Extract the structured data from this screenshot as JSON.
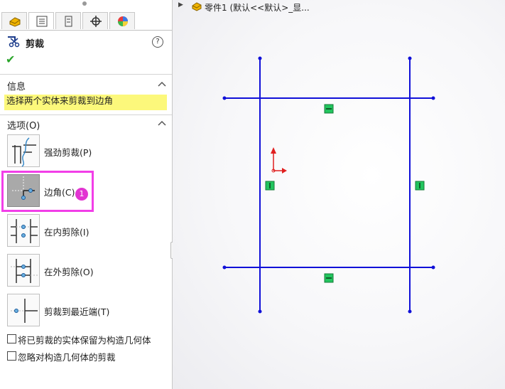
{
  "tabs": [
    "feature-manager",
    "property-manager",
    "configuration-manager",
    "dimxpert-manager",
    "display-manager"
  ],
  "feature": {
    "title": "剪裁",
    "help_label": "?"
  },
  "info": {
    "header": "信息",
    "message": "选择两个实体来剪裁到边角"
  },
  "options": {
    "header": "选项(O)",
    "items": [
      {
        "label": "强劲剪裁(P)",
        "icon": "power-trim-icon",
        "selected": false
      },
      {
        "label": "边角(C)",
        "icon": "corner-trim-icon",
        "selected": true
      },
      {
        "label": "在内剪除(I)",
        "icon": "trim-away-inside-icon",
        "selected": false
      },
      {
        "label": "在外剪除(O)",
        "icon": "trim-away-outside-icon",
        "selected": false
      },
      {
        "label": "剪裁到最近端(T)",
        "icon": "trim-to-closest-icon",
        "selected": false
      }
    ],
    "checkboxes": [
      {
        "label": "将已剪裁的实体保留为构造几何体",
        "checked": false
      },
      {
        "label": "忽略对构造几何体的剪裁",
        "checked": false
      }
    ]
  },
  "annotation": {
    "step": "1"
  },
  "breadcrumb": {
    "part": "零件1  (默认<<默认>_显..."
  },
  "colors": {
    "sketch_line": "#1010d8",
    "relation_marker": "#22c55e",
    "highlight": "#f23ee8",
    "info_bg": "#fcf87b"
  }
}
